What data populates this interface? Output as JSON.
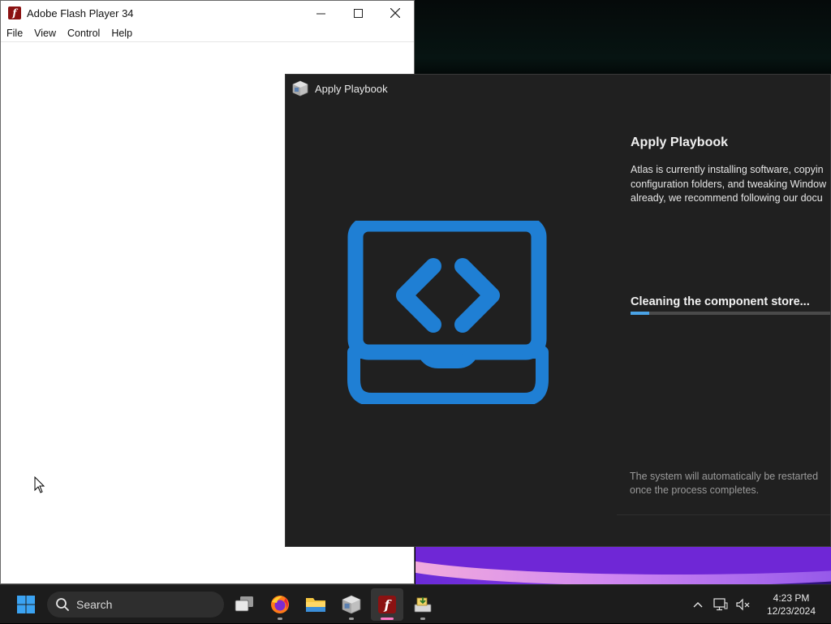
{
  "flash_window": {
    "title": "Adobe Flash Player 34",
    "icon_letter": "f",
    "menu": [
      "File",
      "View",
      "Control",
      "Help"
    ],
    "controls": {
      "minimize": "—",
      "maximize": "☐",
      "close": "✕"
    }
  },
  "playbook_window": {
    "title": "Apply Playbook",
    "heading": "Apply Playbook",
    "description_lines": [
      "Atlas is currently installing software, copyin",
      "configuration folders, and tweaking Window",
      "already, we recommend following our docu"
    ],
    "status": "Cleaning the component store...",
    "progress": 0.09,
    "footnote": "The system will automatically be restarted once the process completes.",
    "accent_color": "#1f7fd4"
  },
  "taskbar": {
    "search_label": "Search",
    "apps": [
      "task-view",
      "firefox",
      "file-explorer",
      "package",
      "flash-player",
      "installer"
    ],
    "active_app": "flash-player",
    "clock": {
      "time": "4:23 PM",
      "date": "12/23/2024"
    }
  }
}
